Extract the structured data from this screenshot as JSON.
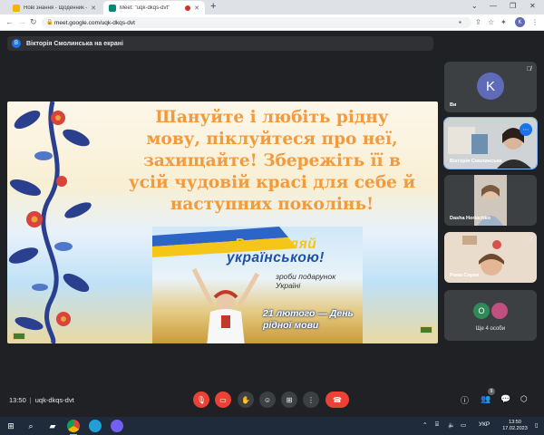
{
  "browser": {
    "tabs": [
      {
        "title": "Нові знання - Щоденник - Елек",
        "active": false
      },
      {
        "title": "Meet: \"uqk-dkqs-dvt\"",
        "active": true
      }
    ],
    "url": "meet.google.com/uqk-dkqs-dvt",
    "profile_initial": "K",
    "icons": {
      "back": "arrow-left-icon",
      "forward": "arrow-right-icon",
      "reload": "reload-icon"
    }
  },
  "meet": {
    "presenter_initial": "B",
    "presenter_text": "Вікторія Смолинська на екрані",
    "slide": {
      "slogan": "Шануйте і любіть рідну мову, піклуйтеся про неї, захищайте! Збережіть її в усій чудовій красі для себе й наступних поколінь!",
      "brand_line1": "Розмовляй",
      "brand_line2": "українською!",
      "gift": "зроби подарунок Україні",
      "date": "21 лютого — День рідної мови"
    },
    "participants": [
      {
        "name": "Ви",
        "initial": "K",
        "muted": true
      },
      {
        "name": "Вікторія Смолинська",
        "muted": false
      },
      {
        "name": "Dasha Horiachko",
        "muted": false
      },
      {
        "name": "Рома Сирик",
        "muted": true
      }
    ],
    "others": {
      "initial": "O",
      "label": "Ще 4 особи"
    },
    "meeting_time": "13:50",
    "meeting_code": "uqk-dkqs-dvt",
    "badge_count": "9"
  },
  "taskbar": {
    "time": "13:50",
    "date": "17.02.2023",
    "lang": "УКР"
  },
  "colors": {
    "meet_bg": "#202124",
    "tile_bg": "#3c4043",
    "red": "#ea4335",
    "accent_blue": "#1a73e8",
    "slogan_orange": "#f39a3d"
  }
}
